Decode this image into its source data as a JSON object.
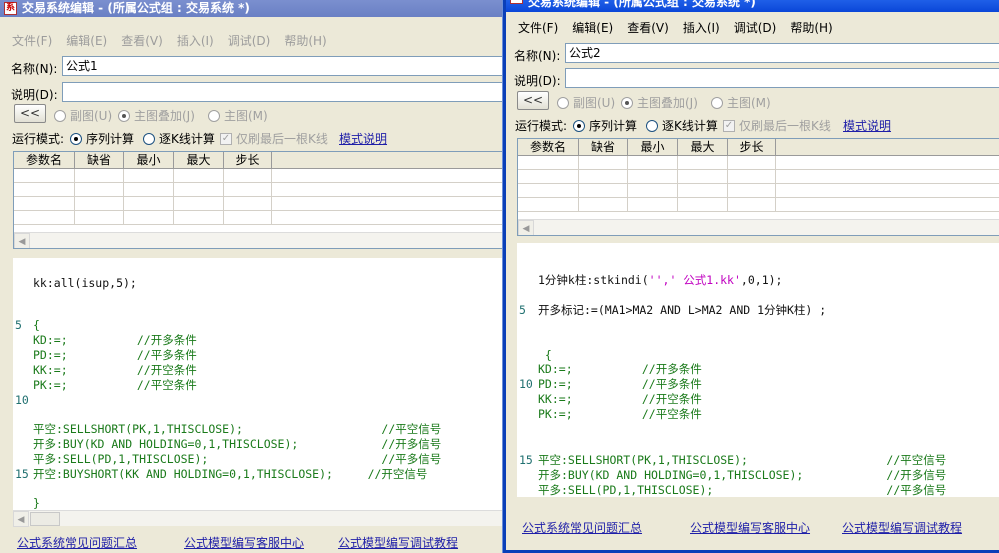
{
  "window1": {
    "title": "交易系统编辑 - (所属公式组 : 交易系统 *)",
    "menu": [
      "文件(F)",
      "编辑(E)",
      "查看(V)",
      "插入(I)",
      "调试(D)",
      "帮助(H)"
    ],
    "name_label": "名称(N):",
    "name_value": "公式1",
    "desc_label": "说明(D):",
    "desc_value": "",
    "collapse_button": "<<",
    "radio_sub": "副图(U)",
    "radio_overlay": "主图叠加(J)",
    "radio_main": "主图(M)",
    "run_mode_label": "运行模式:",
    "run_seq": "序列计算",
    "run_kline": "逐K线计算",
    "refresh_last": "仅刷最后一根K线",
    "mode_help": "模式说明",
    "param_headers": [
      "参数名",
      "缺省",
      "最小",
      "最大",
      "步长"
    ],
    "code_lines": [
      {
        "num": "",
        "text": ""
      },
      {
        "num": "",
        "text": "kk:all(isup,5);"
      },
      {
        "num": "",
        "text": ""
      },
      {
        "num": "",
        "text": ""
      },
      {
        "num": "5",
        "text": "{"
      },
      {
        "num": "",
        "text": "KD:=;          //开多条件"
      },
      {
        "num": "",
        "text": "PD:=;          //平多条件"
      },
      {
        "num": "",
        "text": "KK:=;          //开空条件"
      },
      {
        "num": "",
        "text": "PK:=;          //平空条件"
      },
      {
        "num": "10",
        "text": ""
      },
      {
        "num": "",
        "text": ""
      },
      {
        "num": "",
        "text": "平空:SELLSHORT(PK,1,THISCLOSE);                    //平空信号"
      },
      {
        "num": "",
        "text": "开多:BUY(KD AND HOLDING=0,1,THISCLOSE);            //开多信号"
      },
      {
        "num": "",
        "text": "平多:SELL(PD,1,THISCLOSE);                         //平多信号"
      },
      {
        "num": "15",
        "text": "开空:BUYSHORT(KK AND HOLDING=0,1,THISCLOSE);     //开空信号"
      },
      {
        "num": "",
        "text": ""
      },
      {
        "num": "",
        "text": "}"
      }
    ],
    "footer_links": [
      "公式系统常见问题汇总",
      "公式模型编写客服中心",
      "公式模型编写调试教程"
    ]
  },
  "window2": {
    "title": "交易系统编辑 - (所属公式组 : 交易系统 *)",
    "menu": [
      "文件(F)",
      "编辑(E)",
      "查看(V)",
      "插入(I)",
      "调试(D)",
      "帮助(H)"
    ],
    "name_label": "名称(N):",
    "name_value": "公式2",
    "desc_label": "说明(D):",
    "desc_value": "",
    "collapse_button": "<<",
    "radio_sub": "副图(U)",
    "radio_overlay": "主图叠加(J)",
    "radio_main": "主图(M)",
    "run_mode_label": "运行模式:",
    "run_seq": "序列计算",
    "run_kline": "逐K线计算",
    "refresh_last": "仅刷最后一根K线",
    "mode_help": "模式说明",
    "param_headers": [
      "参数名",
      "缺省",
      "最小",
      "最大",
      "步长"
    ],
    "code_lines": [
      {
        "num": "",
        "text": ""
      },
      {
        "num": "",
        "text": ""
      },
      {
        "num": "",
        "text": "1分钟k柱:stkindi('',' 公式1.kk',0,1);"
      },
      {
        "num": "",
        "text": ""
      },
      {
        "num": "5",
        "text": "开多标记:=(MA1>MA2 AND L>MA2 AND 1分钟K柱) ;"
      },
      {
        "num": "",
        "text": ""
      },
      {
        "num": "",
        "text": ""
      },
      {
        "num": "",
        "text": " {"
      },
      {
        "num": "",
        "text": "KD:=;          //开多条件"
      },
      {
        "num": "10",
        "text": "PD:=;          //平多条件"
      },
      {
        "num": "",
        "text": "KK:=;          //开空条件"
      },
      {
        "num": "",
        "text": "PK:=;          //平空条件"
      },
      {
        "num": "",
        "text": ""
      },
      {
        "num": "",
        "text": ""
      },
      {
        "num": "15",
        "text": "平空:SELLSHORT(PK,1,THISCLOSE);                    //平空信号"
      },
      {
        "num": "",
        "text": "开多:BUY(KD AND HOLDING=0,1,THISCLOSE);            //开多信号"
      },
      {
        "num": "",
        "text": "平多:SELL(PD,1,THISCLOSE);                         //平多信号"
      }
    ],
    "footer_links": [
      "公式系统常见问题汇总",
      "公式模型编写客服中心",
      "公式模型编写调试教程"
    ]
  }
}
